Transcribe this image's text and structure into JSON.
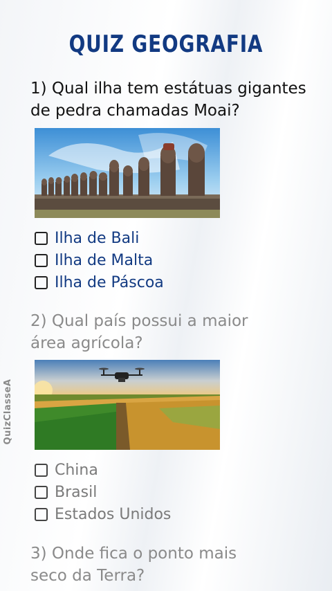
{
  "title": "QUIZ GEOGRAFIA",
  "watermark": "QuizClasseA",
  "questions": [
    {
      "text": "1) Qual ilha tem estátuas gigantes de pedra chamadas Moai?",
      "image": "moai-statues-photo",
      "options": [
        "Ilha de Bali",
        "Ilha de Malta",
        "Ilha de Páscoa"
      ]
    },
    {
      "text": "2) Qual país possui a maior área agrícola?",
      "image": "drone-over-farmland-photo",
      "options": [
        "China",
        "Brasil",
        "Estados Unidos"
      ]
    },
    {
      "text": "3) Onde fica o ponto mais seco da Terra?"
    }
  ]
}
